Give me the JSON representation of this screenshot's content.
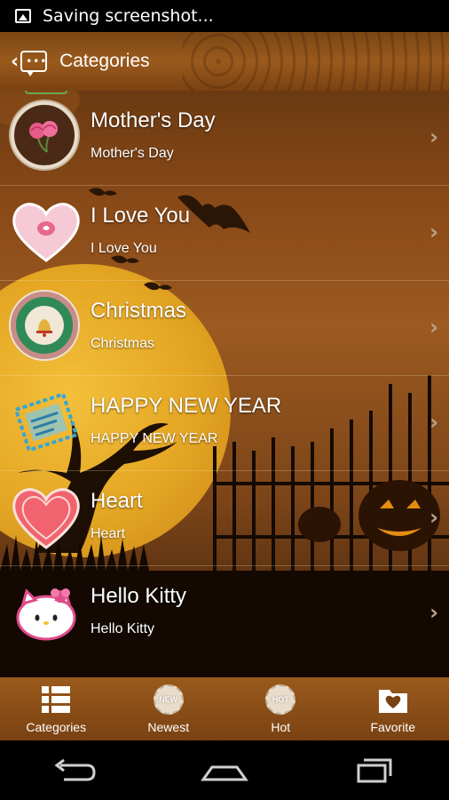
{
  "status_bar": {
    "text": "Saving screenshot..."
  },
  "app_bar": {
    "title": "Categories"
  },
  "categories": [
    {
      "title": "Mother's Day",
      "subtitle": "Mother's Day",
      "icon": "carnation-badge-icon"
    },
    {
      "title": "I Love You",
      "subtitle": "I Love You",
      "icon": "pink-heart-icon"
    },
    {
      "title": "Christmas",
      "subtitle": "Christmas",
      "icon": "christmas-bells-badge-icon"
    },
    {
      "title": "HAPPY NEW YEAR",
      "subtitle": "HAPPY NEW YEAR",
      "icon": "new-year-stamp-icon"
    },
    {
      "title": "Heart",
      "subtitle": "Heart",
      "icon": "red-heart-icon"
    },
    {
      "title": "Hello Kitty",
      "subtitle": "Hello Kitty",
      "icon": "hello-kitty-icon"
    }
  ],
  "tabs": [
    {
      "label": "Categories",
      "icon": "list-icon"
    },
    {
      "label": "Newest",
      "icon": "new-seal-icon",
      "badge": "NEW"
    },
    {
      "label": "Hot",
      "icon": "hot-seal-icon",
      "badge": "HOT"
    },
    {
      "label": "Favorite",
      "icon": "heart-folder-icon"
    }
  ],
  "colors": {
    "bar_brown": "#8a4e18",
    "moon": "#e4a523",
    "text": "#ffffff"
  }
}
